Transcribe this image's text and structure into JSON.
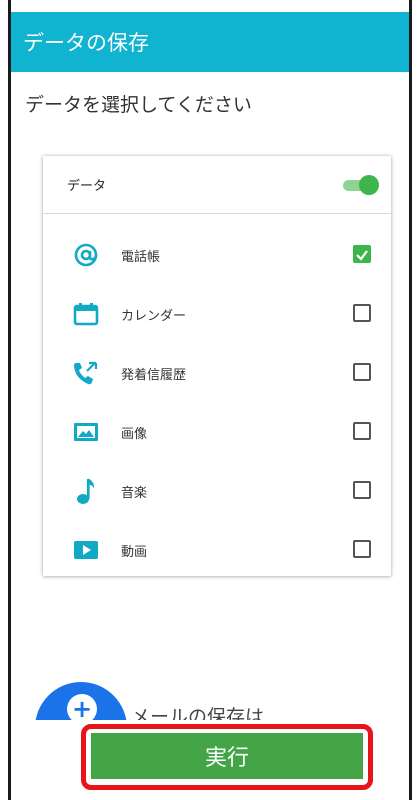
{
  "appbar": {
    "title": "データの保存"
  },
  "subtitle": "データを選択してください",
  "card": {
    "header_label": "データ",
    "toggle_on": true,
    "items": [
      {
        "label": "電話帳",
        "icon": "at-sign-icon",
        "checked": true
      },
      {
        "label": "カレンダー",
        "icon": "calendar-icon",
        "checked": false
      },
      {
        "label": "発着信履歴",
        "icon": "call-log-icon",
        "checked": false
      },
      {
        "label": "画像",
        "icon": "image-icon",
        "checked": false
      },
      {
        "label": "音楽",
        "icon": "music-note-icon",
        "checked": false
      },
      {
        "label": "動画",
        "icon": "video-icon",
        "checked": false
      }
    ]
  },
  "promo": {
    "text": "メールの保存は",
    "icon": "add-circle-icon"
  },
  "action": {
    "execute_label": "実行"
  },
  "colors": {
    "appbar": "#10b3d0",
    "accent_green": "#3db54a",
    "icon_teal": "#12a9c6",
    "highlight_red": "#e8141b",
    "promo_blue": "#1a73e8"
  }
}
